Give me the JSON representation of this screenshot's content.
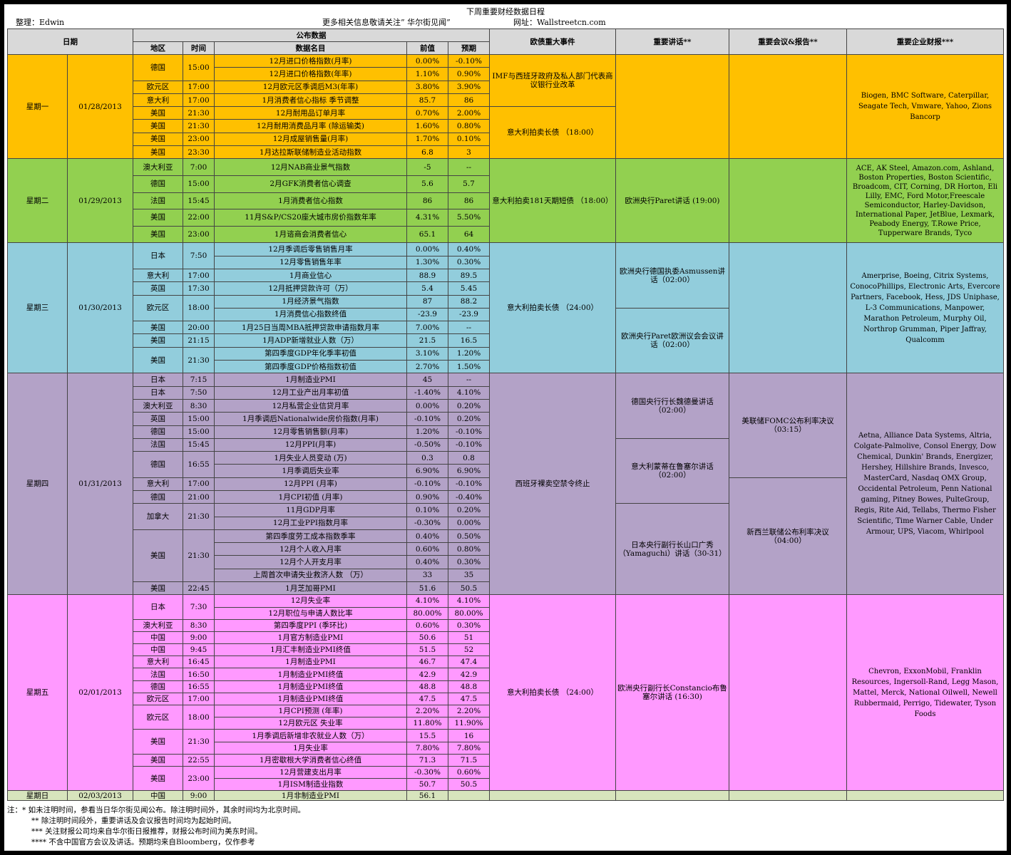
{
  "title": "下周重要财经数据日程",
  "author": "整理：Edwin",
  "follow": "更多相关信息敬请关注” 华尔街见闻”",
  "site": "网址：Wallstreetcn.com",
  "headers": {
    "date": "日期",
    "pub": "公布数据",
    "region": "地区",
    "time": "时间",
    "item": "数据名目",
    "prev": "前值",
    "forecast": "预期",
    "events": "欧债重大事件",
    "speeches": "重要讲话**",
    "meetings": "重要会议&报告**",
    "earnings": "重要企业财报***"
  },
  "days": [
    {
      "weekday": "星期一",
      "date": "01/28/2013",
      "rows": [
        {
          "region": "德国",
          "time": "15:00",
          "item": "12月进口价格指数(月率)",
          "prev": "0.00%",
          "forecast": "-0.10%"
        },
        {
          "region": "",
          "time": "",
          "item": "12月进口价格指数(年率)",
          "prev": "1.10%",
          "forecast": "0.90%"
        },
        {
          "region": "欧元区",
          "time": "17:00",
          "item": "12月欧元区季调后M3(年率)",
          "prev": "3.80%",
          "forecast": "3.90%"
        },
        {
          "region": "意大利",
          "time": "17:00",
          "item": "1月消费者信心指标 季节调整",
          "prev": "85.7",
          "forecast": "86"
        },
        {
          "region": "美国",
          "time": "21:30",
          "item": "12月耐用品订单月率",
          "prev": "0.70%",
          "forecast": "2.00%"
        },
        {
          "region": "美国",
          "time": "21:30",
          "item": "12月耐用消费品月率 (除运输类)",
          "prev": "1.60%",
          "forecast": "0.80%"
        },
        {
          "region": "美国",
          "time": "23:00",
          "item": "12月成屋销售量(月率)",
          "prev": "1.70%",
          "forecast": "0.10%"
        },
        {
          "region": "美国",
          "time": "23:30",
          "item": "1月达拉斯联储制造业活动指数",
          "prev": "6.8",
          "forecast": "3"
        }
      ],
      "events": [
        "IMF与西班牙政府及私人部门代表商议银行业改革",
        "意大利拍卖长债 （18:00）"
      ],
      "earnings": "Biogen, BMC Software, Caterpillar, Seagate Tech, Vmware, Yahoo, Zions Bancorp"
    },
    {
      "weekday": "星期二",
      "date": "01/29/2013",
      "rows": [
        {
          "region": "澳大利亚",
          "time": "7:00",
          "item": "12月NAB商业景气指数",
          "prev": "-5",
          "forecast": "--"
        },
        {
          "region": "德国",
          "time": "15:00",
          "item": "2月GFK消费者信心调查",
          "prev": "5.6",
          "forecast": "5.7"
        },
        {
          "region": "法国",
          "time": "15:45",
          "item": "1月消费者信心指数",
          "prev": "86",
          "forecast": "86"
        },
        {
          "region": "美国",
          "time": "22:00",
          "item": "11月S&P/CS20座大城市房价指数年率",
          "prev": "4.31%",
          "forecast": "5.50%"
        },
        {
          "region": "美国",
          "time": "23:00",
          "item": "1月谘商会消费者信心",
          "prev": "65.1",
          "forecast": "64"
        }
      ],
      "events": [
        "意大利拍卖181天期短债 （18:00）"
      ],
      "speeches": [
        "欧洲央行Paret讲话 (19:00)"
      ],
      "earnings": "ACE, AK Steel, Amazon.com, Ashland, Boston Properties, Boston Scientific, Broadcom, CIT, Corning, DR Horton, Eli Lilly, EMC, Ford Motor,Freescale Semiconductor, Harley-Davidson, International Paper, JetBlue, Lexmark, Peabody Energy, T.Rowe Price, Tupperware Brands, Tyco"
    },
    {
      "weekday": "星期三",
      "date": "01/30/2013",
      "rows": [
        {
          "region": "日本",
          "time": "7:50",
          "item": "12月季调后零售销售月率",
          "prev": "0.00%",
          "forecast": "0.40%"
        },
        {
          "region": "",
          "time": "",
          "item": "12月零售销售年率",
          "prev": "1.30%",
          "forecast": "0.30%"
        },
        {
          "region": "意大利",
          "time": "17:00",
          "item": "1月商业信心",
          "prev": "88.9",
          "forecast": "89.5"
        },
        {
          "region": "英国",
          "time": "17:30",
          "item": "12月抵押贷款许可（万）",
          "prev": "5.4",
          "forecast": "5.45"
        },
        {
          "region": "欧元区",
          "time": "18:00",
          "item": "1月经济景气指数",
          "prev": "87",
          "forecast": "88.2"
        },
        {
          "region": "",
          "time": "",
          "item": "1月消费信心指数终值",
          "prev": "-23.9",
          "forecast": "-23.9"
        },
        {
          "region": "美国",
          "time": "20:00",
          "item": "1月25日当周MBA抵押贷款申请指数月率",
          "prev": "7.00%",
          "forecast": "--"
        },
        {
          "region": "美国",
          "time": "21:15",
          "item": "1月ADP新增就业人数（万）",
          "prev": "21.5",
          "forecast": "16.5"
        },
        {
          "region": "美国",
          "time": "21:30",
          "item": "第四季度GDP年化季率初值",
          "prev": "3.10%",
          "forecast": "1.20%"
        },
        {
          "region": "",
          "time": "",
          "item": "第四季度GDP价格指数初值",
          "prev": "2.70%",
          "forecast": "1.50%"
        }
      ],
      "events": [
        "意大利拍卖长债 （24:00）"
      ],
      "speeches": [
        "欧洲央行德国执委Asmussen讲话（02:00）",
        "欧洲央行Paret欧洲议会会议讲话（02:00）"
      ],
      "earnings": "Amerprise, Boeing, Citrix Systems, ConocoPhillips, Electronic Arts, Evercore Partners, Facebook, Hess, JDS Uniphase, L-3 Communications, Manpower, Marathon Petroleum, Murphy Oil, Northrop Grumman, Piper Jaffray, Qualcomm"
    },
    {
      "weekday": "星期四",
      "date": "01/31/2013",
      "rows": [
        {
          "region": "日本",
          "time": "7:15",
          "item": "1月制造业PMI",
          "prev": "45",
          "forecast": "--"
        },
        {
          "region": "日本",
          "time": "7:50",
          "item": "12月工业产出月率初值",
          "prev": "-1.40%",
          "forecast": "4.10%"
        },
        {
          "region": "澳大利亚",
          "time": "8:30",
          "item": "12月私营企业信贷月率",
          "prev": "0.00%",
          "forecast": "0.20%"
        },
        {
          "region": "英国",
          "time": "15:00",
          "item": "1月季调后Nationalwide房价指数(月率)",
          "prev": "-0.10%",
          "forecast": "0.20%"
        },
        {
          "region": "德国",
          "time": "15:00",
          "item": "12月零售销售额(月率)",
          "prev": "1.20%",
          "forecast": "-0.10%"
        },
        {
          "region": "法国",
          "time": "15:45",
          "item": "12月PPI(月率)",
          "prev": "-0.50%",
          "forecast": "-0.10%"
        },
        {
          "region": "德国",
          "time": "16:55",
          "item": "1月失业人员变动 (万)",
          "prev": "0.3",
          "forecast": "0.8"
        },
        {
          "region": "",
          "time": "",
          "item": "1月季调后失业率",
          "prev": "6.90%",
          "forecast": "6.90%"
        },
        {
          "region": "意大利",
          "time": "17:00",
          "item": "12月PPI (月率)",
          "prev": "-0.10%",
          "forecast": "-0.10%"
        },
        {
          "region": "德国",
          "time": "21:00",
          "item": "1月CPI初值 (月率)",
          "prev": "0.90%",
          "forecast": "-0.40%"
        },
        {
          "region": "加拿大",
          "time": "21:30",
          "item": "11月GDP月率",
          "prev": "0.10%",
          "forecast": "0.20%"
        },
        {
          "region": "",
          "time": "",
          "item": "12月工业PPI指数月率",
          "prev": "-0.30%",
          "forecast": "0.00%"
        },
        {
          "region": "美国",
          "time": "21:30",
          "item": "第四季度劳工成本指数季率",
          "prev": "0.40%",
          "forecast": "0.50%"
        },
        {
          "region": "",
          "time": "",
          "item": "12月个人收入月率",
          "prev": "0.60%",
          "forecast": "0.80%"
        },
        {
          "region": "",
          "time": "",
          "item": "12月个人开支月率",
          "prev": "0.40%",
          "forecast": "0.30%"
        },
        {
          "region": "",
          "time": "",
          "item": "上周首次申请失业救济人数 （万）",
          "prev": "33",
          "forecast": "35"
        },
        {
          "region": "美国",
          "time": "22:45",
          "item": "1月芝加哥PMI",
          "prev": "51.6",
          "forecast": "50.5"
        }
      ],
      "events": [
        "西班牙裸卖空禁令终止"
      ],
      "speeches": [
        "德国央行行长魏德曼讲话（02:00）",
        "意大利蒙蒂在鲁塞尔讲话（02:00）",
        "日本央行副行长山口广秀（Yamaguchi）讲话（30-31）"
      ],
      "meetings": [
        "美联储FOMC公布利率决议（03:15）",
        "新西兰联储公布利率决议（04:00）"
      ],
      "earnings": "Aetna, Alliance Data Systems, Altria, Colgate-Palmolive, Consol Energy, Dow Chemical, Dunkin' Brands, Energizer, Hershey, Hillshire Brands, Invesco, MasterCard, Nasdaq OMX Group, Occidental Petroleum, Penn National gaming, Pitney Bowes, PulteGroup, Regis, Rite Aid, Tellabs, Thermo Fisher Scientific, Time Warner Cable, Under Armour, UPS, Viacom, Whirlpool"
    },
    {
      "weekday": "星期五",
      "date": "02/01/2013",
      "rows": [
        {
          "region": "日本",
          "time": "7:30",
          "item": "12月失业率",
          "prev": "4.10%",
          "forecast": "4.10%"
        },
        {
          "region": "",
          "time": "",
          "item": "12月职位与申请人数比率",
          "prev": "80.00%",
          "forecast": "80.00%"
        },
        {
          "region": "澳大利亚",
          "time": "8:30",
          "item": "第四季度PPI (季环比)",
          "prev": "0.60%",
          "forecast": "0.30%"
        },
        {
          "region": "中国",
          "time": "9:00",
          "item": "1月官方制造业PMI",
          "prev": "50.6",
          "forecast": "51"
        },
        {
          "region": "中国",
          "time": "9:45",
          "item": "1月汇丰制造业PMI终值",
          "prev": "51.5",
          "forecast": "52"
        },
        {
          "region": "意大利",
          "time": "16:45",
          "item": "1月制造业PMI",
          "prev": "46.7",
          "forecast": "47.4"
        },
        {
          "region": "法国",
          "time": "16:50",
          "item": "1月制造业PMI终值",
          "prev": "42.9",
          "forecast": "42.9"
        },
        {
          "region": "德国",
          "time": "16:55",
          "item": "1月制造业PMI终值",
          "prev": "48.8",
          "forecast": "48.8"
        },
        {
          "region": "欧元区",
          "time": "17:00",
          "item": "1月制造业PMI终值",
          "prev": "47.5",
          "forecast": "47.5"
        },
        {
          "region": "欧元区",
          "time": "18:00",
          "item": "1月CPI预测 (年率)",
          "prev": "2.20%",
          "forecast": "2.20%"
        },
        {
          "region": "",
          "time": "",
          "item": "12月欧元区 失业率",
          "prev": "11.80%",
          "forecast": "11.90%"
        },
        {
          "region": "美国",
          "time": "21:30",
          "item": "1月季调后新增非农就业人数（万）",
          "prev": "15.5",
          "forecast": "16"
        },
        {
          "region": "",
          "time": "",
          "item": "1月失业率",
          "prev": "7.80%",
          "forecast": "7.80%"
        },
        {
          "region": "美国",
          "time": "22:55",
          "item": "1月密歇根大学消费者信心终值",
          "prev": "71.3",
          "forecast": "71.5"
        },
        {
          "region": "美国",
          "time": "23:00",
          "item": "12月营建支出月率",
          "prev": "-0.30%",
          "forecast": "0.60%"
        },
        {
          "region": "",
          "time": "",
          "item": "1月ISM制造业指数",
          "prev": "50.7",
          "forecast": "50.5"
        }
      ],
      "events": [
        "意大利拍卖长债 （24:00）"
      ],
      "speeches": [
        "欧洲央行副行长Constancio布鲁塞尔讲话 (16:30)"
      ],
      "earnings": "Chevron, ExxonMobil, Franklin Resources, Ingersoll-Rand, Legg Mason, Mattel, Merck, National Oilwell, Newell Rubbermaid, Perrigo, Tidewater, Tyson Foods"
    },
    {
      "weekday": "星期日",
      "date": "02/03/2013",
      "rows": [
        {
          "region": "中国",
          "time": "9:00",
          "item": "1月非制造业PMI",
          "prev": "56.1",
          "forecast": ""
        }
      ]
    }
  ],
  "notes": [
    "注：* 如未注明时间，参看当日华尔街见闻公布。除注明时间外，其余时间均为北京时间。",
    "** 除注明时间段外，重要讲话及会议报告时间均为起始时间。",
    "*** 关注财报公司均来自华尔街日报推荐，财报公布时间为美东时间。",
    "**** 不含中国官方会议及讲话。预期均来自Bloomberg，仅作参考"
  ]
}
